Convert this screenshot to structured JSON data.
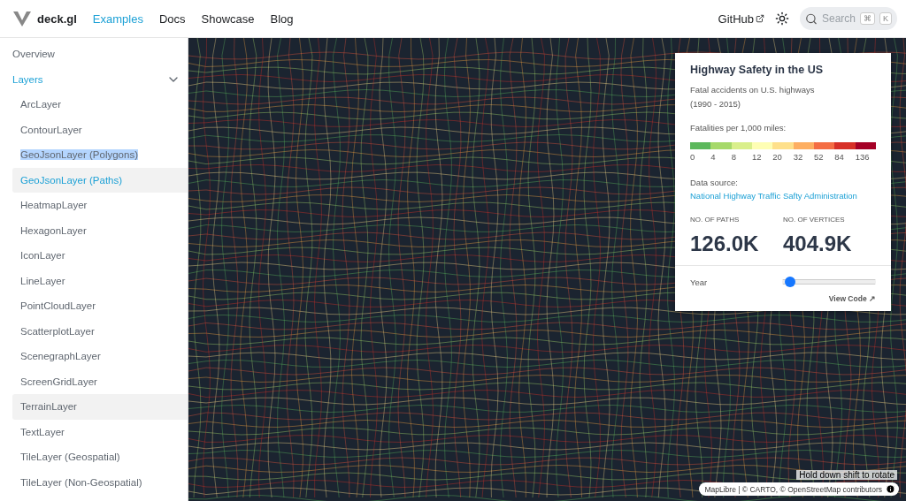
{
  "header": {
    "logo": "deck.gl",
    "nav": [
      {
        "label": "Examples",
        "selected": true
      },
      {
        "label": "Docs",
        "selected": false
      },
      {
        "label": "Showcase",
        "selected": false
      },
      {
        "label": "Blog",
        "selected": false
      }
    ],
    "github": "GitHub",
    "search": {
      "placeholder": "Search",
      "keys": [
        "⌘",
        "K"
      ]
    }
  },
  "sidebar": {
    "items": [
      {
        "label": "Overview",
        "selected": false
      },
      {
        "label": "Layers",
        "selected": true,
        "expanded": true,
        "children": [
          {
            "label": "ArcLayer",
            "selected": false,
            "hovered": false,
            "text_selected": false
          },
          {
            "label": "ContourLayer",
            "selected": false,
            "hovered": false,
            "text_selected": false
          },
          {
            "label": "GeoJsonLayer (Polygons)",
            "selected": false,
            "hovered": false,
            "text_selected": true
          },
          {
            "label": "GeoJsonLayer (Paths)",
            "selected": true,
            "hovered": false,
            "text_selected": false
          },
          {
            "label": "HeatmapLayer",
            "selected": false,
            "hovered": false,
            "text_selected": false
          },
          {
            "label": "HexagonLayer",
            "selected": false,
            "hovered": false,
            "text_selected": false
          },
          {
            "label": "IconLayer",
            "selected": false,
            "hovered": false,
            "text_selected": false
          },
          {
            "label": "LineLayer",
            "selected": false,
            "hovered": false,
            "text_selected": false
          },
          {
            "label": "PointCloudLayer",
            "selected": false,
            "hovered": false,
            "text_selected": false
          },
          {
            "label": "ScatterplotLayer",
            "selected": false,
            "hovered": false,
            "text_selected": false
          },
          {
            "label": "ScenegraphLayer",
            "selected": false,
            "hovered": false,
            "text_selected": false
          },
          {
            "label": "ScreenGridLayer",
            "selected": false,
            "hovered": false,
            "text_selected": false
          },
          {
            "label": "TerrainLayer",
            "selected": false,
            "hovered": true,
            "text_selected": false
          },
          {
            "label": "TextLayer",
            "selected": false,
            "hovered": false,
            "text_selected": false
          },
          {
            "label": "TileLayer (Geospatial)",
            "selected": false,
            "hovered": false,
            "text_selected": false
          },
          {
            "label": "TileLayer (Non-Geospatial)",
            "selected": false,
            "hovered": false,
            "text_selected": false
          }
        ]
      }
    ]
  },
  "panel": {
    "title": "Highway Safety in the US",
    "subtitle": "Fatal accidents on U.S. highways",
    "years": "(1990 - 2015)",
    "legend_title": "Fatalities per 1,000 miles:",
    "legend": [
      {
        "label": "0",
        "color": "#5cb85c"
      },
      {
        "label": "4",
        "color": "#a6d96a"
      },
      {
        "label": "8",
        "color": "#d9ef8b"
      },
      {
        "label": "12",
        "color": "#fefeb4"
      },
      {
        "label": "20",
        "color": "#fee08b"
      },
      {
        "label": "32",
        "color": "#fdae61"
      },
      {
        "label": "52",
        "color": "#f46d43"
      },
      {
        "label": "84",
        "color": "#d73027"
      },
      {
        "label": "136",
        "color": "#a50026"
      }
    ],
    "source_label": "Data source:",
    "source_link": "National Highway Traffic Safty Administration",
    "stats": [
      {
        "label": "NO. OF PATHS",
        "value": "126.0K"
      },
      {
        "label": "NO. OF VERTICES",
        "value": "404.9K"
      }
    ],
    "slider": {
      "label": "Year",
      "level": 0.03
    },
    "view_code": "View Code ↗"
  },
  "map": {
    "hint": "Hold down shift to rotate",
    "attribution": "MapLibre | © CARTO, © OpenStreetMap contributors"
  }
}
